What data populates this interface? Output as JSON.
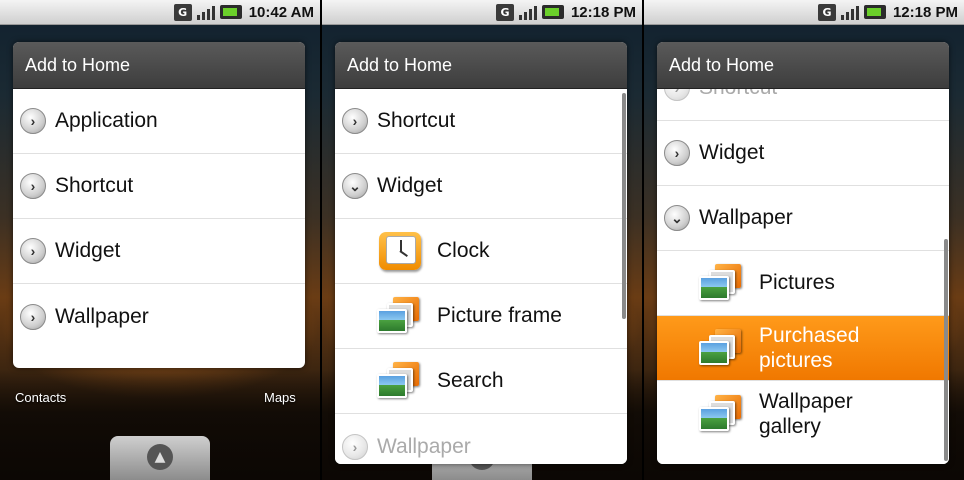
{
  "screens": [
    {
      "status": {
        "time": "10:42 AM",
        "data_icon": "G"
      },
      "dialog": {
        "title": "Add to Home",
        "rows": [
          {
            "label": "Application",
            "icon": "chevron-right-circle-icon"
          },
          {
            "label": "Shortcut",
            "icon": "chevron-right-circle-icon"
          },
          {
            "label": "Widget",
            "icon": "chevron-right-circle-icon"
          },
          {
            "label": "Wallpaper",
            "icon": "chevron-right-circle-icon"
          }
        ]
      },
      "home": {
        "contacts_label": "Contacts",
        "maps_label": "Maps"
      }
    },
    {
      "status": {
        "time": "12:18 PM",
        "data_icon": "G"
      },
      "dialog": {
        "title": "Add to Home",
        "rows": [
          {
            "label": "Shortcut",
            "icon": "chevron-right-circle-icon"
          },
          {
            "label": "Widget",
            "icon": "chevron-down-circle-icon"
          },
          {
            "label": "Clock",
            "icon": "clock-icon"
          },
          {
            "label": "Picture frame",
            "icon": "photos-icon"
          },
          {
            "label": "Search",
            "icon": "photos-icon"
          },
          {
            "label": "Wallpaper",
            "icon": "chevron-right-circle-icon"
          }
        ]
      }
    },
    {
      "status": {
        "time": "12:18 PM",
        "data_icon": "G"
      },
      "dialog": {
        "title": "Add to Home",
        "rows": [
          {
            "label": "Shortcut",
            "icon": "chevron-right-circle-icon"
          },
          {
            "label": "Widget",
            "icon": "chevron-right-circle-icon"
          },
          {
            "label": "Wallpaper",
            "icon": "chevron-down-circle-icon"
          },
          {
            "label": "Pictures",
            "icon": "photos-icon"
          },
          {
            "label": "Purchased pictures",
            "icon": "photos-icon",
            "selected": true
          },
          {
            "label": "Wallpaper gallery",
            "icon": "photos-icon"
          }
        ]
      }
    }
  ],
  "colors": {
    "selection": "#f07800",
    "title_bar": "#3d3d3d",
    "battery": "#6bd02a"
  }
}
